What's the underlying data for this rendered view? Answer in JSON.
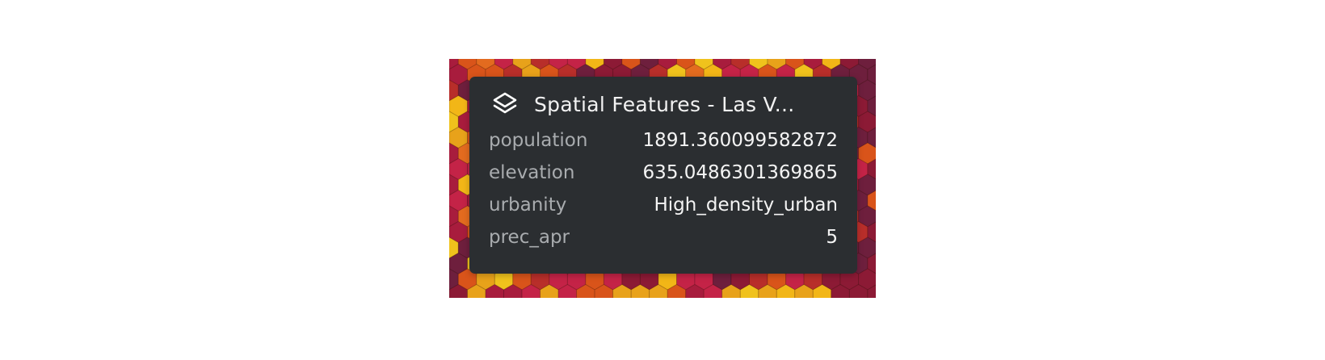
{
  "map": {
    "colors": [
      "#f2b617",
      "#e8a21a",
      "#d9541a",
      "#c42347",
      "#a81c3d",
      "#e36b1f",
      "#f0c21c",
      "#b82e2a",
      "#6e1f3d",
      "#8c1a35"
    ]
  },
  "tooltip": {
    "icon": "layers-icon",
    "title": "Spatial Features - Las V...",
    "rows": [
      {
        "key": "population",
        "value": "1891.360099582872"
      },
      {
        "key": "elevation",
        "value": "635.0486301369865"
      },
      {
        "key": "urbanity",
        "value": "High_density_urban"
      },
      {
        "key": "prec_apr",
        "value": "5"
      }
    ]
  }
}
